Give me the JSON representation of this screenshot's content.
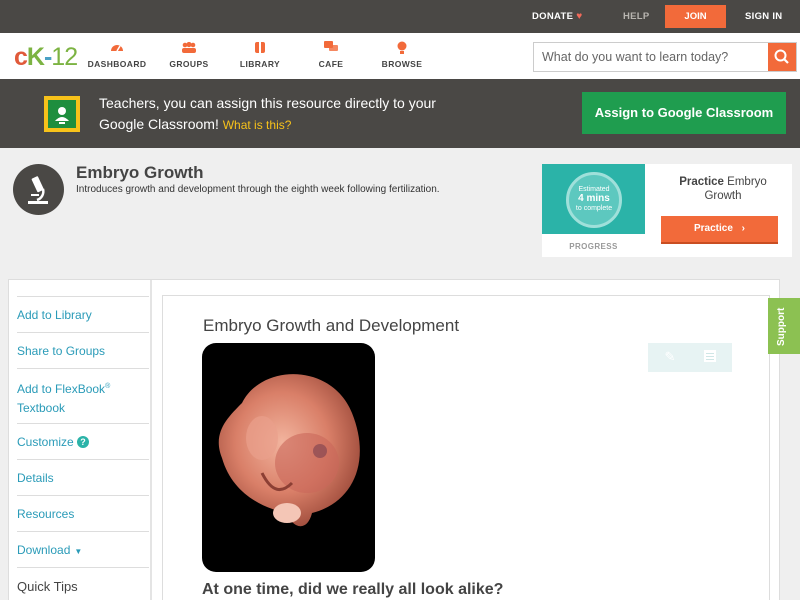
{
  "topbar": {
    "donate": "DONATE",
    "help": "HELP",
    "join": "JOIN",
    "signin": "SIGN IN"
  },
  "logo": {
    "text": "CK-12"
  },
  "nav": {
    "items": [
      {
        "label": "DASHBOARD",
        "icon": "dashboard-icon"
      },
      {
        "label": "GROUPS",
        "icon": "groups-icon"
      },
      {
        "label": "LIBRARY",
        "icon": "library-icon"
      },
      {
        "label": "CAFE",
        "icon": "cafe-icon"
      },
      {
        "label": "BROWSE",
        "icon": "browse-icon"
      }
    ],
    "search_placeholder": "What do you want to learn today?"
  },
  "banner": {
    "message": "Teachers, you can assign this resource directly to your Google Classroom!",
    "what_link": "What is this?",
    "assign_button": "Assign to Google Classroom"
  },
  "header": {
    "title": "Embryo Growth",
    "description": "Introduces growth and development through the eighth week following fertilization."
  },
  "practice": {
    "circle_top": "Estimated",
    "circle_mid": "4 mins",
    "circle_bottom": "to complete",
    "progress_label": "PROGRESS",
    "title_bold": "Practice",
    "title_rest": "Embryo Growth",
    "button": "Practice"
  },
  "sidebar": {
    "items": [
      "Add to Library",
      "Share to Groups",
      "Add to FlexBook",
      "Textbook",
      "Customize",
      "Details",
      "Resources",
      "Download",
      "Quick Tips"
    ],
    "registered": "®",
    "help_glyph": "?"
  },
  "content": {
    "heading": "Embryo Growth and Development",
    "question": "At one time, did we really all look alike?"
  },
  "support": {
    "label": "Support"
  },
  "colors": {
    "accent": "#f26a3a",
    "dark": "#4a4845",
    "green": "#1f9d4f",
    "teal": "#2a9bb8"
  }
}
